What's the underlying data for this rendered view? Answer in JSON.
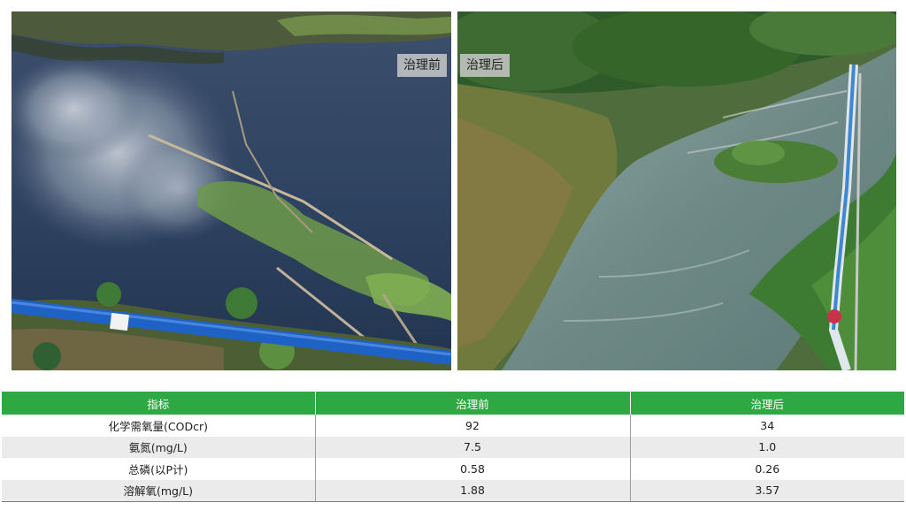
{
  "photos": {
    "before_caption": "治理前",
    "after_caption": "治理后"
  },
  "table": {
    "headers": [
      "指标",
      "治理前",
      "治理后"
    ],
    "rows": [
      [
        "化学需氧量(CODcr)",
        "92",
        "34"
      ],
      [
        "氨氮(mg/L)",
        "7.5",
        "1.0"
      ],
      [
        "总磷(以P计)",
        "0.58",
        "0.26"
      ],
      [
        "溶解氧(mg/L)",
        "1.88",
        "3.57"
      ]
    ]
  },
  "colors": {
    "header_green": "#2da843",
    "alt_row": "#ebebeb"
  }
}
